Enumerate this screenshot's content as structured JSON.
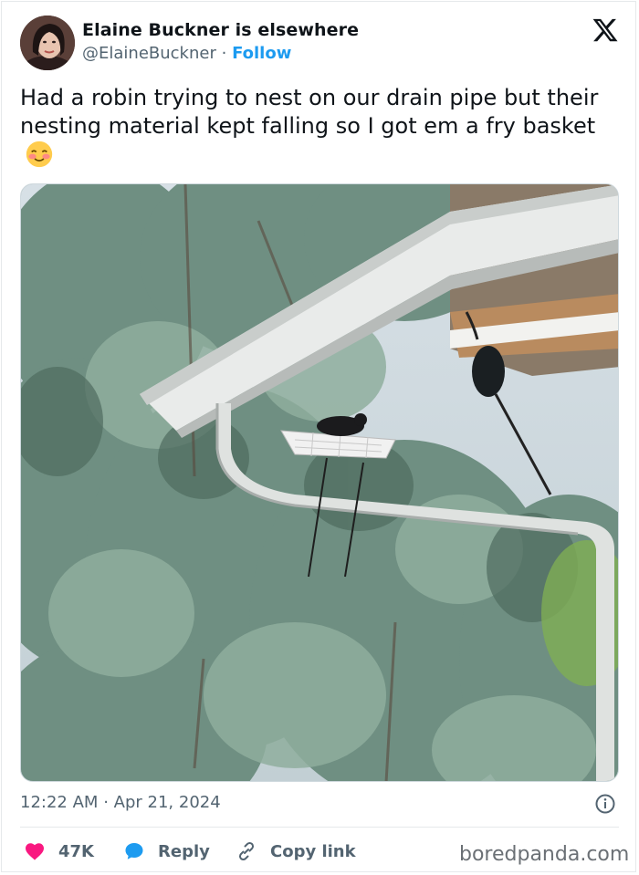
{
  "author": {
    "display_name": "Elaine Buckner is elsewhere",
    "handle": "@ElaineBuckner",
    "separator": "·",
    "follow_label": "Follow"
  },
  "post": {
    "text": "Had a robin trying to nest on our drain pipe but their nesting material kept falling so I got em a fry basket",
    "emoji_icon": "smiling-face-with-blush-icon"
  },
  "photo": {
    "subject_icon": "photo-robin-in-fry-basket-on-gutter"
  },
  "meta": {
    "time": "12:22 AM",
    "separator": "·",
    "date": "Apr 21, 2024",
    "info_icon": "info-icon"
  },
  "actions": {
    "likes_count": "47K",
    "reply_label": "Reply",
    "copy_link_label": "Copy link"
  },
  "watermark": "boredpanda.com",
  "colors": {
    "accent_blue": "#1d9bf0",
    "like_red": "#f91880",
    "secondary_text": "#536471",
    "primary_text": "#0f1419"
  }
}
